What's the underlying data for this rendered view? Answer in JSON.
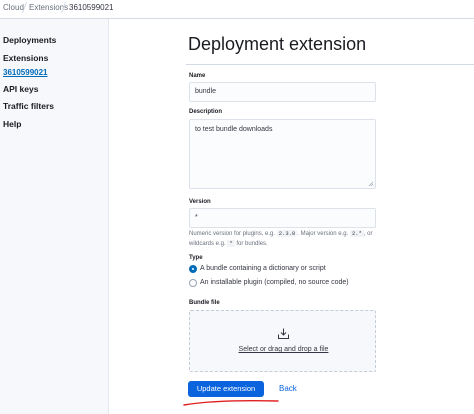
{
  "breadcrumb": [
    "Cloud",
    "Extensions",
    "3610599021"
  ],
  "sidebar": {
    "items": [
      {
        "label": "Deployments"
      },
      {
        "label": "Extensions"
      },
      {
        "label": "3610599021"
      },
      {
        "label": "API keys"
      },
      {
        "label": "Traffic filters"
      },
      {
        "label": "Help"
      }
    ]
  },
  "page": {
    "title": "Deployment extension"
  },
  "form": {
    "name_label": "Name",
    "name_value": "bundle",
    "description_label": "Description",
    "description_value": "to test bundle downloads",
    "version_label": "Version",
    "version_value": "*",
    "version_help": {
      "part1": "Numeric version for plugins, e.g.",
      "code1": "2.3.0",
      "part2": ". Major version e.g.",
      "code2": "2.*",
      "part3": ", or wildcards e.g.",
      "code3": "*",
      "part4": "for bundles."
    },
    "type_label": "Type",
    "type_options": [
      {
        "label": "A bundle containing a dictionary or script",
        "selected": true
      },
      {
        "label": "An installable plugin (compiled, no source code)",
        "selected": false
      }
    ],
    "bundle_label": "Bundle file",
    "dropzone_text": "Select or drag and drop a file",
    "dropzone_icon": "upload-icon"
  },
  "actions": {
    "primary": "Update extension",
    "secondary": "Back"
  },
  "colors": {
    "primary": "#0b64dd",
    "annotation": "#e02020"
  }
}
